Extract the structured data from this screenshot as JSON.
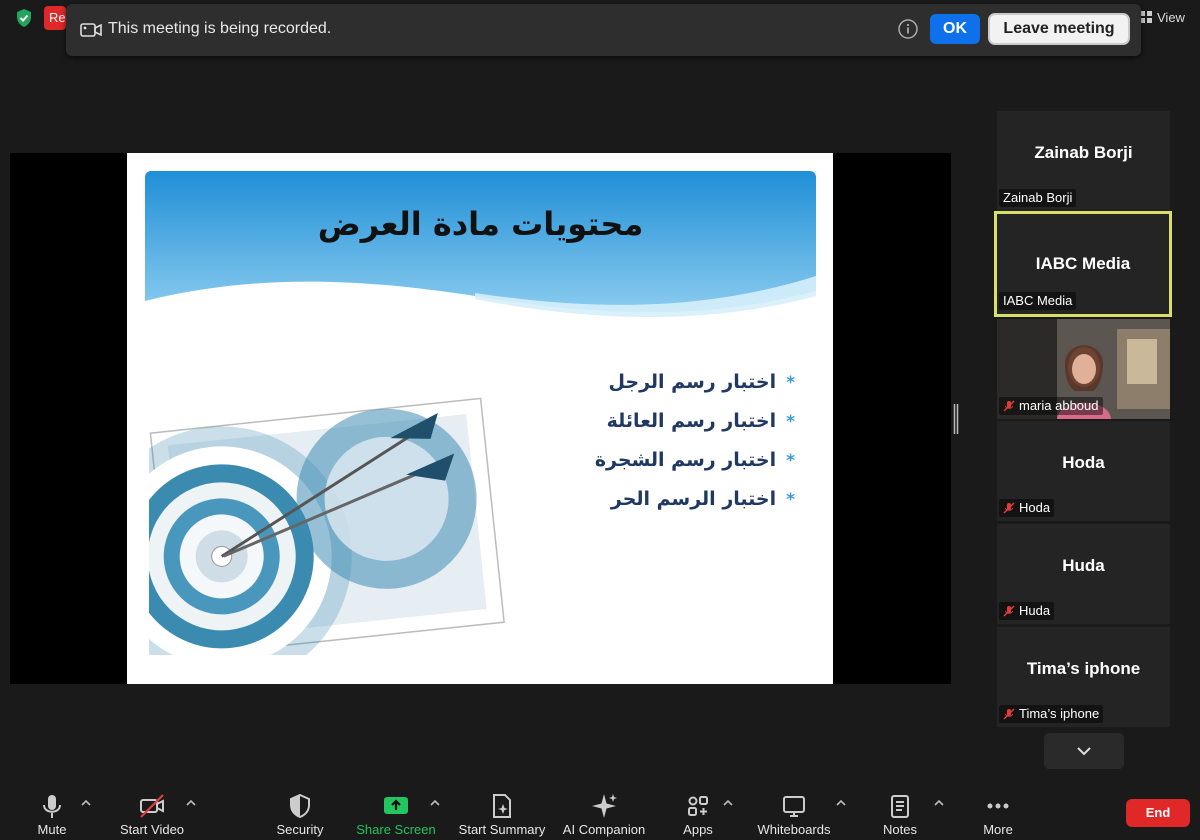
{
  "app": {
    "rec_badge": "Re",
    "view_label": "View"
  },
  "notice": {
    "text": "This meeting is being recorded.",
    "ok_label": "OK",
    "leave_label": "Leave meeting"
  },
  "slide": {
    "title": "محتويات مادة العرض",
    "bullets": [
      "اختبار رسم الرجل",
      "اختبار رسم العائلة",
      "اختبار رسم الشجرة",
      "اختبار الرسم الحر"
    ]
  },
  "participants": [
    {
      "display": "Zainab Borji",
      "label": "Zainab Borji",
      "muted": false,
      "active": false
    },
    {
      "display": "IABC Media",
      "label": "IABC Media",
      "muted": false,
      "active": true
    },
    {
      "display": "",
      "label": "maria abboud",
      "muted": true,
      "video": true
    },
    {
      "display": "Hoda",
      "label": "Hoda",
      "muted": true
    },
    {
      "display": "Huda",
      "label": "Huda",
      "muted": true
    },
    {
      "display": "Tima’s iphone",
      "label": "Tima’s iphone",
      "muted": true
    }
  ],
  "toolbar": {
    "mute": "Mute",
    "start_video": "Start Video",
    "security": "Security",
    "share_screen": "Share Screen",
    "start_summary": "Start Summary",
    "ai_companion": "AI Companion",
    "apps": "Apps",
    "whiteboards": "Whiteboards",
    "notes": "Notes",
    "more": "More",
    "end": "End"
  },
  "colors": {
    "accent_blue": "#0e71eb",
    "share_green": "#22c55e",
    "end_red": "#e02828",
    "active_speaker": "#d8e06a"
  }
}
